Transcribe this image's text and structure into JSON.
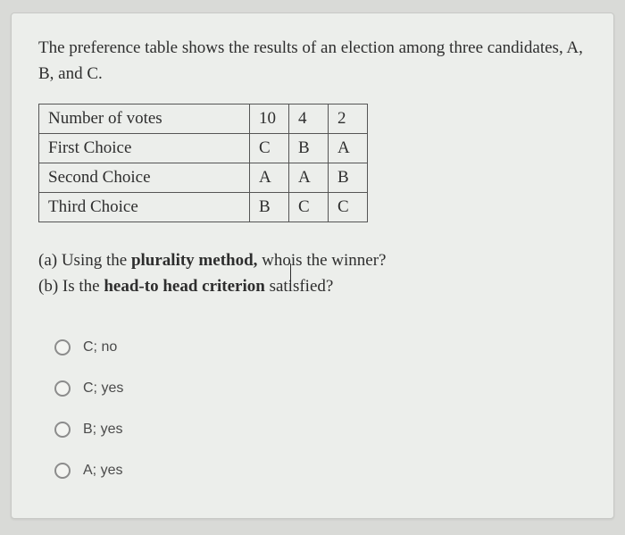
{
  "intro": "The preference table shows the results of an election among three candidates, A, B, and C.",
  "table": {
    "rows": [
      {
        "label": "Number of votes",
        "c1": "10",
        "c2": "4",
        "c3": "2"
      },
      {
        "label": "First Choice",
        "c1": "C",
        "c2": "B",
        "c3": "A"
      },
      {
        "label": "Second Choice",
        "c1": "A",
        "c2": "A",
        "c3": "B"
      },
      {
        "label": "Third Choice",
        "c1": "B",
        "c2": "C",
        "c3": "C"
      }
    ]
  },
  "questions": {
    "a_prefix": "(a) Using the ",
    "a_bold": "plurality method,",
    "a_rest_1": " who",
    "a_rest_2": "is the winner?",
    "b_prefix": "(b) Is the ",
    "b_bold": "head-to head criterion",
    "b_rest": " satisfied?"
  },
  "options": [
    {
      "label": "C; no"
    },
    {
      "label": "C; yes"
    },
    {
      "label": "B; yes"
    },
    {
      "label": "A; yes"
    }
  ]
}
